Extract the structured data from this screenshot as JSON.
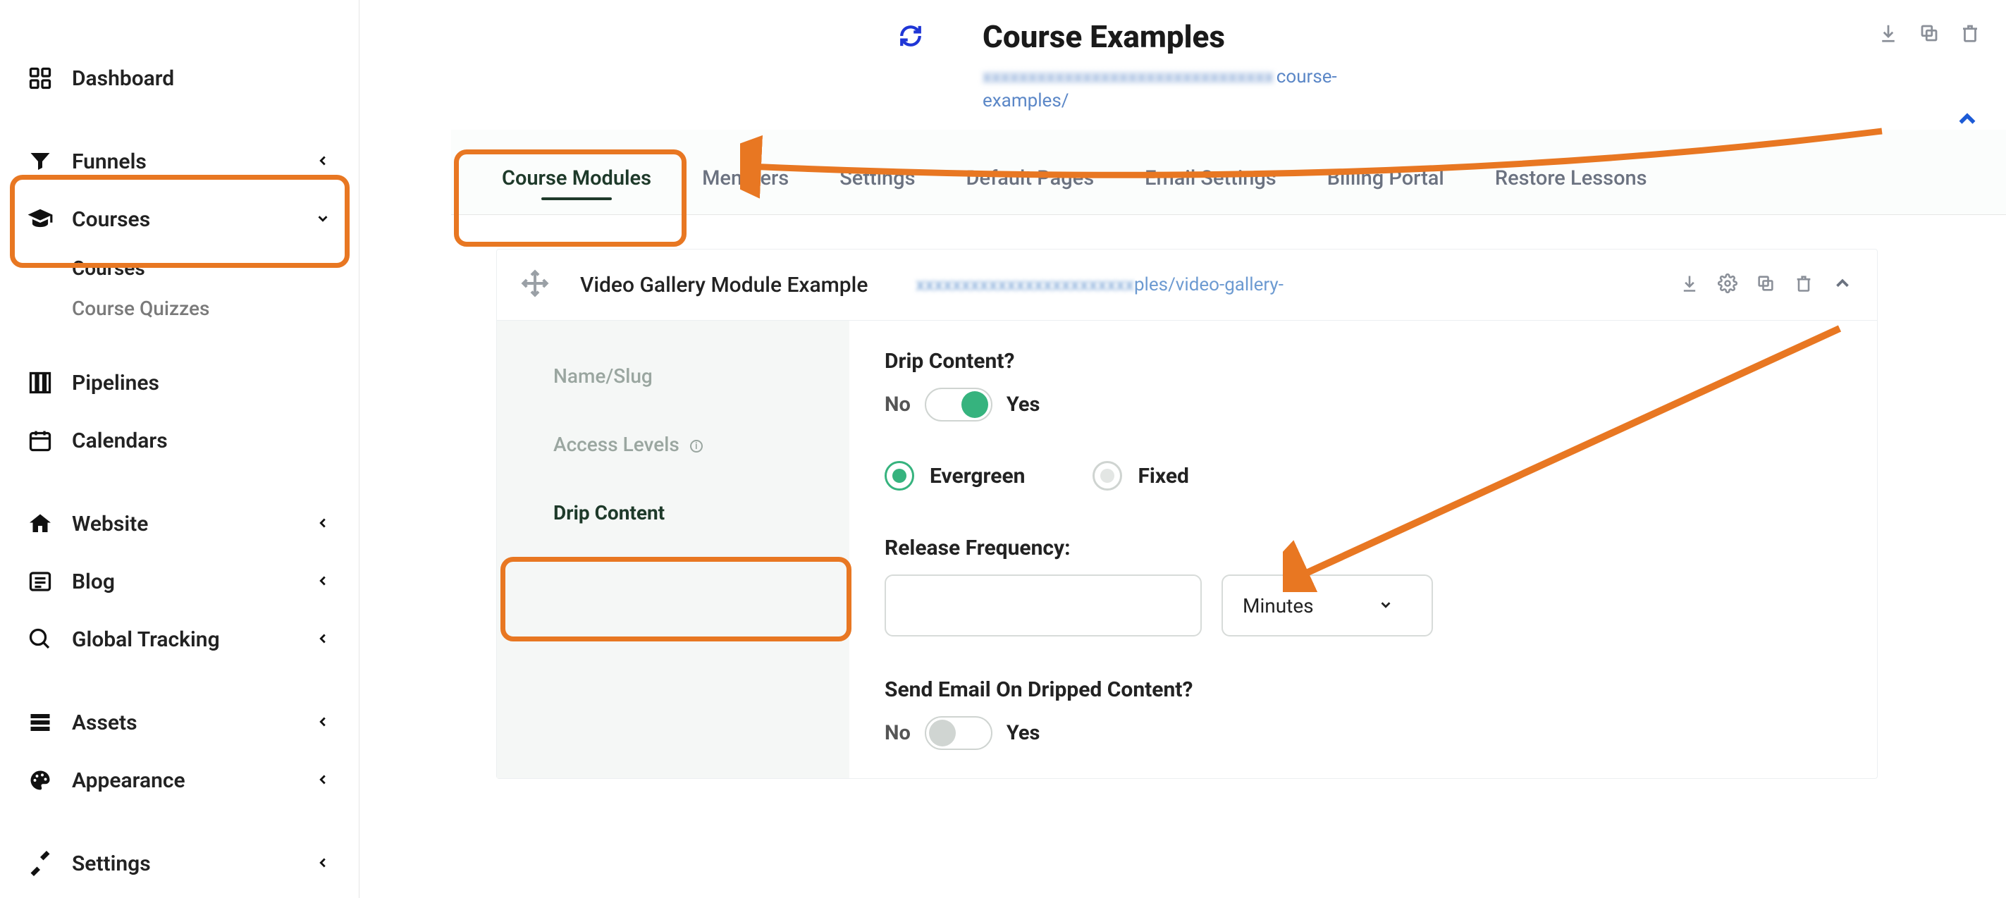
{
  "sidebar": {
    "items": [
      {
        "label": "Dashboard"
      },
      {
        "label": "Funnels"
      },
      {
        "label": "Courses",
        "children": [
          {
            "label": "Courses"
          },
          {
            "label": "Course Quizzes"
          }
        ]
      },
      {
        "label": "Pipelines"
      },
      {
        "label": "Calendars"
      },
      {
        "label": "Website"
      },
      {
        "label": "Blog"
      },
      {
        "label": "Global Tracking"
      },
      {
        "label": "Assets"
      },
      {
        "label": "Appearance"
      },
      {
        "label": "Settings"
      }
    ]
  },
  "header": {
    "title": "Course Examples",
    "url_obscured": "xxxxxxxxxxxxxxxxxxxxxxxxxxxxxxxx",
    "url_suffix": "course-examples/"
  },
  "tabs": [
    "Course Modules",
    "Members",
    "Settings",
    "Default Pages",
    "Email Settings",
    "Billing Portal",
    "Restore Lessons"
  ],
  "module": {
    "title": "Video Gallery Module Example",
    "url_obscured": "xxxxxxxxxxxxxxxxxxxxxxxx",
    "url_suffix": "ples/video-gallery-",
    "nav": [
      "Name/Slug",
      "Access Levels",
      "Drip Content"
    ],
    "drip": {
      "heading": "Drip Content?",
      "no_label": "No",
      "yes_label": "Yes",
      "evergreen_label": "Evergreen",
      "fixed_label": "Fixed",
      "release_heading": "Release Frequency:",
      "freq_value": "",
      "freq_unit": "Minutes",
      "email_heading": "Send Email On Dripped Content?"
    }
  }
}
